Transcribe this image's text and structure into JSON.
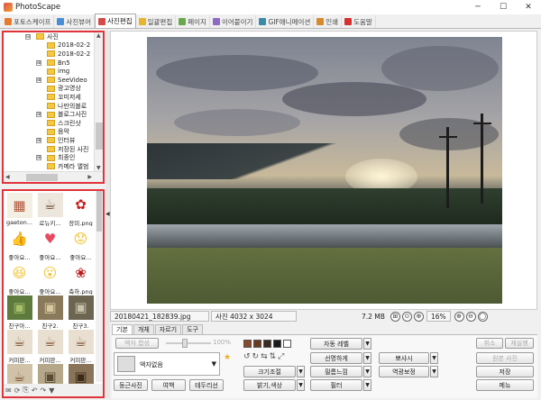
{
  "window": {
    "title": "PhotoScape",
    "minimize": "─",
    "maximize": "☐",
    "close": "✕"
  },
  "tabs": [
    {
      "label": "포토스케이프",
      "color": "#e87a2b"
    },
    {
      "label": "사진뷰어",
      "color": "#4a8fd6"
    },
    {
      "label": "사진편집",
      "color": "#d64a4a",
      "active": true
    },
    {
      "label": "일괄편집",
      "color": "#e8b42b"
    },
    {
      "label": "페이지",
      "color": "#6aa84f"
    },
    {
      "label": "이어붙이기",
      "color": "#8e6ac4"
    },
    {
      "label": "GIF애니메이션",
      "color": "#3a8aa8"
    },
    {
      "label": "인쇄",
      "color": "#d68a2b"
    },
    {
      "label": "도움말",
      "color": "#d63030"
    }
  ],
  "tree": {
    "items": [
      {
        "label": "사진",
        "expand": "⊟",
        "depth": 0
      },
      {
        "label": "2018-02-2",
        "expand": "",
        "depth": 1
      },
      {
        "label": "2018-02-2",
        "expand": "",
        "depth": 1
      },
      {
        "label": "Bn5",
        "expand": "⊞",
        "depth": 1
      },
      {
        "label": "img",
        "expand": "",
        "depth": 1
      },
      {
        "label": "SeeVideo",
        "expand": "⊞",
        "depth": 1
      },
      {
        "label": "광고영상",
        "expand": "",
        "depth": 1
      },
      {
        "label": "꼬미저세",
        "expand": "",
        "depth": 1
      },
      {
        "label": "나만의블로",
        "expand": "",
        "depth": 1
      },
      {
        "label": "블로그사진",
        "expand": "⊞",
        "depth": 1
      },
      {
        "label": "스크린샷",
        "expand": "",
        "depth": 1
      },
      {
        "label": "음악",
        "expand": "",
        "depth": 1
      },
      {
        "label": "인터뷰",
        "expand": "⊞",
        "depth": 1
      },
      {
        "label": "저장된 사진",
        "expand": "",
        "depth": 1
      },
      {
        "label": "최종인",
        "expand": "⊞",
        "depth": 1
      },
      {
        "label": "카메라 앨범",
        "expand": "",
        "depth": 1
      }
    ],
    "up_arrow": "▲",
    "down_arrow": "▼",
    "left_arrow": "◀",
    "right_arrow": "▶"
  },
  "thumbnails": [
    {
      "caption": "gaeton...",
      "glyph": "▦",
      "bg": "#f4efe3",
      "fg": "#b0553a"
    },
    {
      "caption": "로뉴키...",
      "glyph": "☕",
      "bg": "#ece6dc",
      "fg": "#6b4a2f"
    },
    {
      "caption": "장미.png",
      "glyph": "✿",
      "bg": "#ffffff",
      "fg": "#c81e1e"
    },
    {
      "caption": "좋아요...",
      "glyph": "👍",
      "bg": "#ffffff",
      "fg": "#3b5998"
    },
    {
      "caption": "좋아요...",
      "glyph": "♥",
      "bg": "#ffffff",
      "fg": "#e84a5f"
    },
    {
      "caption": "좋아요...",
      "glyph": "😟",
      "bg": "#ffffff",
      "fg": "#f2c230"
    },
    {
      "caption": "좋아요...",
      "glyph": "😆",
      "bg": "#ffffff",
      "fg": "#f2c230"
    },
    {
      "caption": "좋아요...",
      "glyph": "😮",
      "bg": "#ffffff",
      "fg": "#f2c230"
    },
    {
      "caption": "축하.png",
      "glyph": "❀",
      "bg": "#ffffff",
      "fg": "#b82020"
    },
    {
      "caption": "친구아...",
      "glyph": "▣",
      "bg": "#5e7a3c",
      "fg": "#a8c06a"
    },
    {
      "caption": "친구2.",
      "glyph": "▣",
      "bg": "#8a7a5c",
      "fg": "#d9c9a0"
    },
    {
      "caption": "친구3.",
      "glyph": "▣",
      "bg": "#6b6552",
      "fg": "#c9c2a8"
    },
    {
      "caption": "커피판...",
      "glyph": "☕",
      "bg": "#e8dfd0",
      "fg": "#7a4a2a"
    },
    {
      "caption": "커피판...",
      "glyph": "☕",
      "bg": "#e8dfd0",
      "fg": "#7a4a2a"
    },
    {
      "caption": "커피판...",
      "glyph": "☕",
      "bg": "#e8dfd0",
      "fg": "#7a4a2a"
    },
    {
      "caption": "",
      "glyph": "☕",
      "bg": "#cfc2a8",
      "fg": "#7a4a2a"
    },
    {
      "caption": "",
      "glyph": "▣",
      "bg": "#b5a78a",
      "fg": "#5a4a32"
    },
    {
      "caption": "",
      "glyph": "▣",
      "bg": "#8a7458",
      "fg": "#3a2a18"
    }
  ],
  "thumb_toolbar": [
    "✉",
    "⟳",
    "⎘",
    "↶",
    "↷",
    "▼"
  ],
  "splitter_arrow": "◀",
  "status": {
    "filename": "20180421_182839.jpg",
    "dimensions": "사진 4032 x 3024",
    "filesize": "7.2 MB",
    "zoom": "16%",
    "tools": [
      "⊞",
      "⊙",
      "⊕",
      "⊕",
      "⊖",
      "◯"
    ]
  },
  "edit_tabs": [
    {
      "label": "기본",
      "on": true
    },
    {
      "label": "개체",
      "on": false
    },
    {
      "label": "자르기",
      "on": false
    },
    {
      "label": "도구",
      "on": false
    }
  ],
  "edit_panel": {
    "frame_fit": "액자 합성",
    "slider_value": "100%",
    "frame_label": "액자없음",
    "round_photo": "둥근사진",
    "margin": "여백",
    "frame_line": "테두리선",
    "auto_level": "자동 레벨",
    "sharpen": "선명하게",
    "backlight": "뽀샤시",
    "resize": "크기조절",
    "film_effect": "필름느낌",
    "backlight_correct": "역광보정",
    "bright_color": "밝기,색상",
    "filter": "필터",
    "undo": "취소",
    "redo": "재실행",
    "original": "원본 사진",
    "save": "저장",
    "menu": "메뉴",
    "dd_arrow": "▼",
    "swatches": [
      "#8a4a2a",
      "#6a3a20",
      "#3a2a20",
      "#1a1a1a",
      "#ffffff"
    ],
    "star": "★"
  }
}
